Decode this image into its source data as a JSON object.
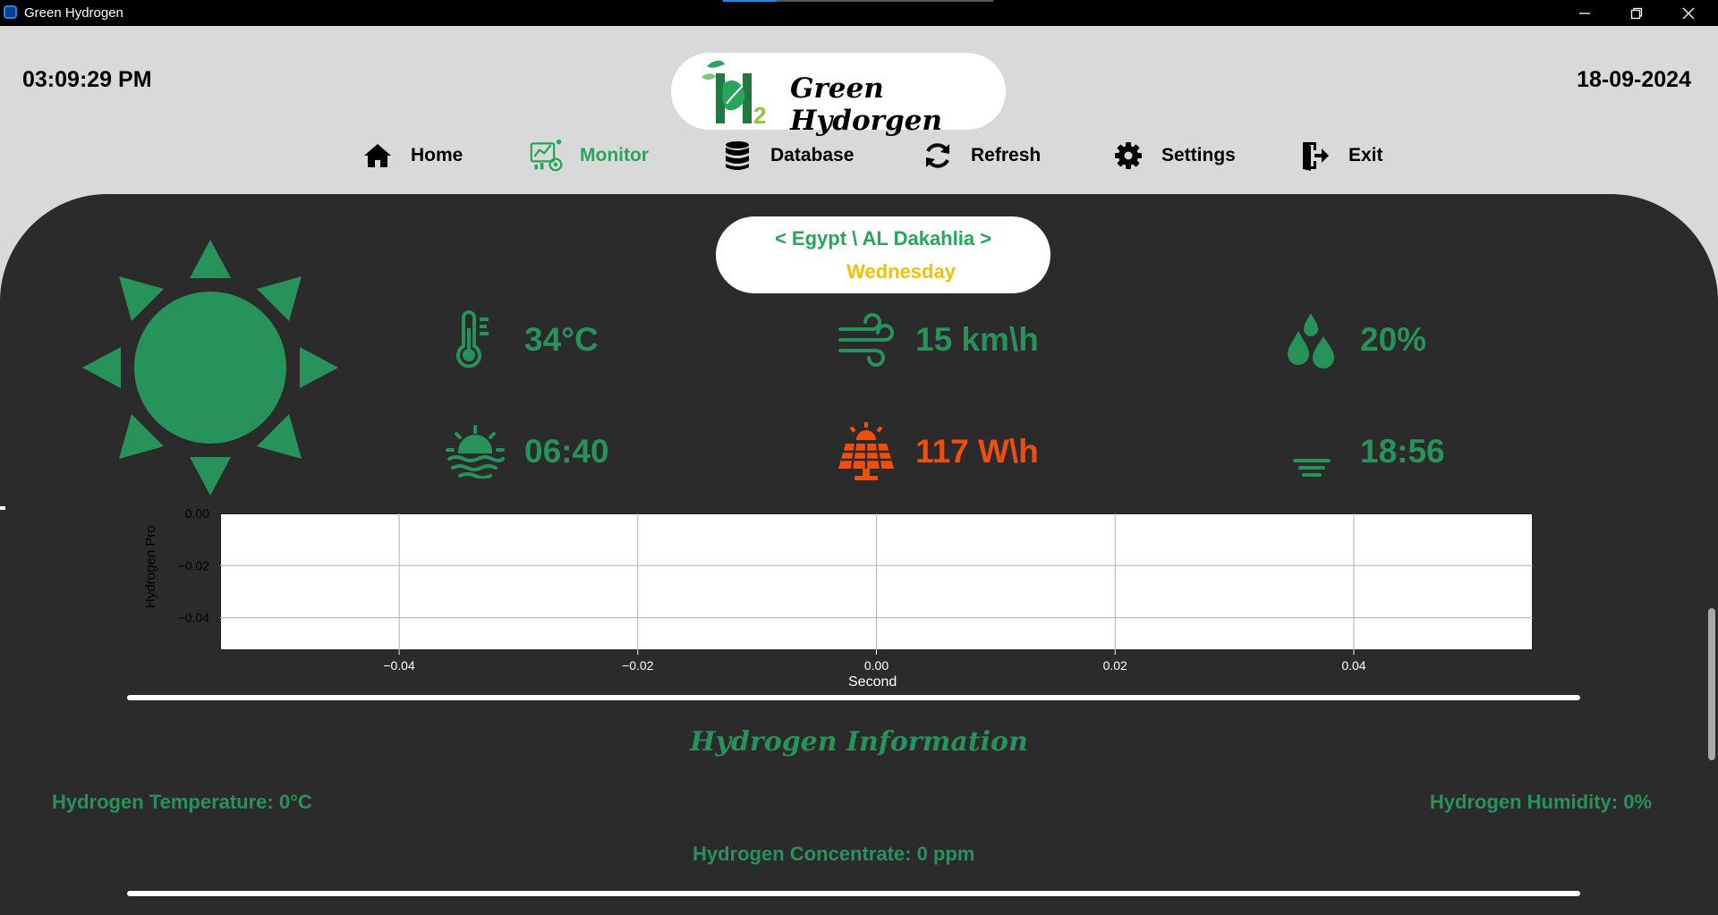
{
  "window": {
    "title": "Green Hydrogen",
    "controls": [
      "minimize-icon",
      "restore-icon",
      "close-icon"
    ]
  },
  "header": {
    "time": "03:09:29 PM",
    "date": "18-09-2024",
    "logo_text": "Green Hydorgen",
    "logo_mark": "H2"
  },
  "nav": [
    {
      "label": "Home",
      "icon": "home-icon"
    },
    {
      "label": "Monitor",
      "icon": "monitor-icon",
      "active": true
    },
    {
      "label": "Database",
      "icon": "database-icon"
    },
    {
      "label": "Refresh",
      "icon": "refresh-icon"
    },
    {
      "label": "Settings",
      "icon": "gear-icon"
    },
    {
      "label": "Exit",
      "icon": "exit-icon"
    }
  ],
  "weather": {
    "location": "< Egypt \\ AL Dakahlia >",
    "weekday": "Wednesday",
    "condition_icon": "sun-icon",
    "temperature": "34°C",
    "wind": "15 km\\h",
    "humidity": "20%",
    "sunrise": "06:40",
    "solar": "117 W\\h",
    "sunset": "18:56"
  },
  "chart_data": {
    "type": "line",
    "xlabel": "Second",
    "ylabel": "Hydrogen Pro",
    "x_ticks": [
      "−0.04",
      "−0.02",
      "0.00",
      "0.02",
      "0.04"
    ],
    "y_ticks": [
      "0.00",
      "−0.02",
      "−0.04"
    ],
    "xlim": [
      -0.055,
      0.055
    ],
    "ylim": [
      -0.055,
      0.0
    ],
    "grid": true,
    "series": []
  },
  "info": {
    "title": "Hydrogen Information",
    "temperature": "Hydrogen Temperature:  0°C",
    "humidity": "Hydrogen Humidity:  0%",
    "concentrate": "Hydrogen Concentrate: 0 ppm"
  },
  "colors": {
    "green": "#27925a",
    "active_green": "#27a559",
    "orange": "#f04e0e",
    "yellow": "#f2c100",
    "panel": "#2b2b2b",
    "header_bg": "#d9d9d9"
  }
}
